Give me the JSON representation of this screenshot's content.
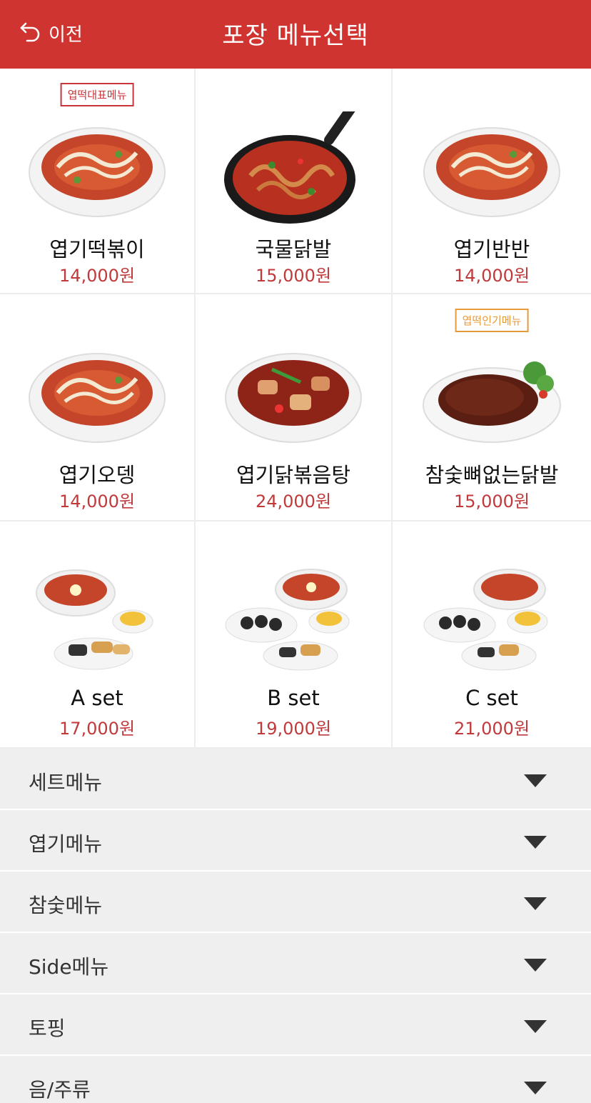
{
  "header": {
    "back_label": "이전",
    "title": "포장 메뉴선택"
  },
  "menu_items": [
    {
      "name": "엽기떡볶이",
      "price": "14,000원",
      "badge": "엽떡대표메뉴",
      "badge_color": "#c9353a",
      "dish": "tteokbokki-bowl"
    },
    {
      "name": "국물닭발",
      "price": "15,000원",
      "badge": "",
      "dish": "chicken-feet-pan"
    },
    {
      "name": "엽기반반",
      "price": "14,000원",
      "badge": "",
      "dish": "tteokbokki-bowl"
    },
    {
      "name": "엽기오뎅",
      "price": "14,000원",
      "badge": "",
      "dish": "tteokbokki-bowl"
    },
    {
      "name": "엽기닭볶음탕",
      "price": "24,000원",
      "badge": "",
      "dish": "braised-chicken-bowl"
    },
    {
      "name": "참숯뼈없는닭발",
      "price": "15,000원",
      "badge": "엽떡인기메뉴",
      "badge_color": "#e79a3a",
      "dish": "grilled-chicken-feet-plate"
    },
    {
      "name": "A set",
      "price": "17,000원",
      "badge": "",
      "dish": "set-a"
    },
    {
      "name": "B set",
      "price": "19,000원",
      "badge": "",
      "dish": "set-b"
    },
    {
      "name": "C set",
      "price": "21,000원",
      "badge": "",
      "dish": "set-c"
    }
  ],
  "categories": [
    {
      "label": "세트메뉴"
    },
    {
      "label": "엽기메뉴"
    },
    {
      "label": "참숯메뉴"
    },
    {
      "label": "Side메뉴"
    },
    {
      "label": "토핑"
    },
    {
      "label": "음/주류"
    }
  ],
  "colors": {
    "header_bg": "#d03430",
    "price": "#c0393b",
    "category_bg": "#efefef"
  }
}
